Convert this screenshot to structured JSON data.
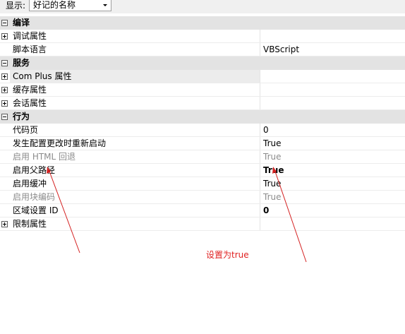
{
  "toolbar": {
    "label": "显示:",
    "select_value": "好记的名称"
  },
  "grid": {
    "cat_compile": "编译",
    "debug": "调试属性",
    "script_lang": "脚本语言",
    "script_lang_value": "VBScript",
    "cat_services": "服务",
    "com_plus": "Com Plus 属性",
    "cache": "缓存属性",
    "session": "会话属性",
    "cat_behavior": "行为",
    "codepage": "代码页",
    "codepage_value": "0",
    "restart": "发生配置更改时重新启动",
    "restart_value": "True",
    "html_fallback": "启用 HTML 回退",
    "html_fallback_value": "True",
    "parent_paths": "启用父路径",
    "parent_paths_value": "True",
    "buffering": "启用缓冲",
    "buffering_value": "True",
    "chunked": "启用块编码",
    "chunked_value": "True",
    "locale": "区域设置 ID",
    "locale_value": "0",
    "limits": "限制属性"
  },
  "annotation": {
    "text": "设置为true",
    "color": "#e02020"
  }
}
